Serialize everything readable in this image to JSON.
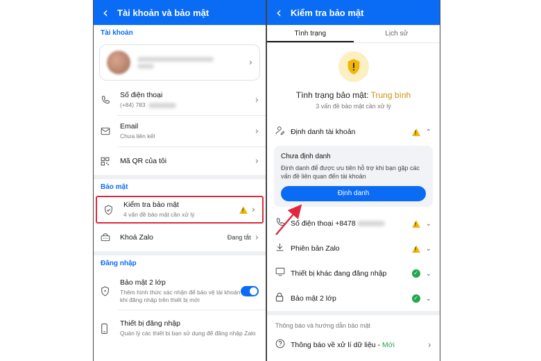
{
  "left": {
    "title": "Tài khoản và bảo mật",
    "section_account": "Tài khoản",
    "rows": {
      "phone": {
        "label": "Số điện thoại",
        "value": "(+84) 783"
      },
      "email": {
        "label": "Email",
        "value": "Chưa liên kết"
      },
      "qr": {
        "label": "Mã QR của tôi"
      }
    },
    "section_security": "Bảo mật",
    "security_check": {
      "label": "Kiểm tra bảo mật",
      "sub": "4 vấn đề bảo mật cần xử lý"
    },
    "lock": {
      "label": "Khoá Zalo",
      "status": "Đang tắt"
    },
    "section_login": "Đăng nhập",
    "twofa": {
      "label": "Bảo mật 2 lớp",
      "sub": "Thêm hình thức xác nhận để bảo vệ tài khoản khi đăng nhập trên thiết bị mới"
    },
    "devices": {
      "label": "Thiết bị đăng nhập",
      "sub": "Quản lý các thiết bị bạn sử dụng để đăng nhập Zalo"
    }
  },
  "right": {
    "title": "Kiểm tra bảo mật",
    "tabs": [
      "Tình trạng",
      "Lịch sử"
    ],
    "status_prefix": "Tình trạng bảo mật:",
    "status_value": "Trung bình",
    "status_sub": "3 vấn đề bảo mật cần xử lý",
    "identity": {
      "label": "Định danh tài khoản",
      "card_title": "Chưa định danh",
      "card_text": "Định danh để được ưu tiên hỗ trợ khi bạn gặp các vấn đề liên quan đến tài khoản",
      "button": "Định danh"
    },
    "phone": {
      "label": "Số điện thoại +8478"
    },
    "version": {
      "label": "Phiên bản Zalo"
    },
    "other_devices": {
      "label": "Thiết bị khác đang đăng nhập"
    },
    "twofa": {
      "label": "Bảo mật 2 lớp"
    },
    "footer_section": "Thông báo và hướng dẫn bảo mật",
    "notice": {
      "label": "Thông báo về xử lí dữ liệu -",
      "tag": "Mới"
    }
  },
  "colors": {
    "accent": "#0a6cf5",
    "warning": "#f2b705",
    "ok": "#21a650",
    "highlight": "#e0283c"
  }
}
